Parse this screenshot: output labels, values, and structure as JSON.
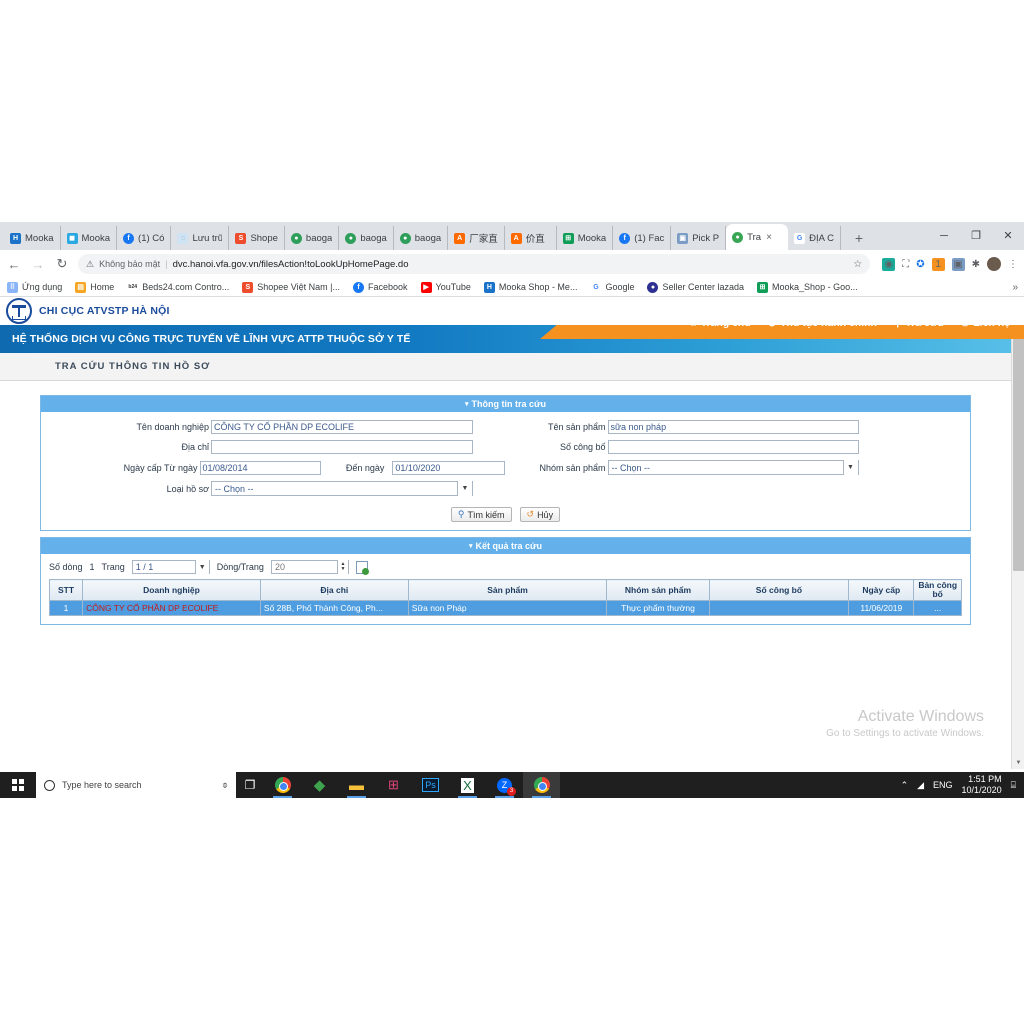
{
  "browser": {
    "tabs": [
      {
        "label": "Mooka",
        "favicon_name": "mooka-h-icon",
        "color": "#1a73c8",
        "glyph": "H",
        "active": false
      },
      {
        "label": "Mooka",
        "favicon_name": "mooka-square-icon",
        "color": "#29a9e1",
        "glyph": "■",
        "active": false
      },
      {
        "label": "(1) Có",
        "favicon_name": "facebook-icon",
        "color": "#1877f2",
        "glyph": "f",
        "active": false
      },
      {
        "label": "Lưu trữ",
        "favicon_name": "archive-icon",
        "color": "#e3eef7",
        "glyph": "◌",
        "active": false
      },
      {
        "label": "Shope",
        "favicon_name": "shopee-icon",
        "color": "#ee4d2d",
        "glyph": "S",
        "active": false
      },
      {
        "label": "baoga",
        "favicon_name": "globe-icon",
        "color": "#2e9e5b",
        "glyph": "●",
        "active": false
      },
      {
        "label": "baoga",
        "favicon_name": "globe-icon",
        "color": "#2e9e5b",
        "glyph": "●",
        "active": false
      },
      {
        "label": "baoga",
        "favicon_name": "globe-icon",
        "color": "#2e9e5b",
        "glyph": "●",
        "active": false
      },
      {
        "label": "厂家直",
        "favicon_name": "alibaba-icon",
        "color": "#ff6a00",
        "glyph": "ⓐ",
        "active": false
      },
      {
        "label": "价直",
        "favicon_name": "alibaba-icon",
        "color": "#ff6a00",
        "glyph": "ⓐ",
        "active": false
      },
      {
        "label": "Mooka",
        "favicon_name": "sheets-icon",
        "color": "#0f9d58",
        "glyph": "⌸",
        "active": false
      },
      {
        "label": "(1) Fac",
        "favicon_name": "facebook-icon",
        "color": "#1877f2",
        "glyph": "f",
        "active": false
      },
      {
        "label": "Pick P",
        "favicon_name": "image-icon",
        "color": "#7b9cc4",
        "glyph": "▣",
        "active": false
      },
      {
        "label": "Tra",
        "favicon_name": "portal-icon",
        "color": "#3aa655",
        "glyph": "●",
        "active": true
      },
      {
        "label": "ĐỊA C",
        "favicon_name": "google-icon",
        "color": "#ffffff",
        "glyph": "G",
        "active": false
      }
    ],
    "new_tab_label": "+",
    "tab_close_label": "×",
    "window_controls": {
      "minimize": "─",
      "maximize": "❐",
      "close": "✕"
    },
    "nav": {
      "back": "←",
      "forward": "→",
      "reload": "↻"
    },
    "omnibox": {
      "security_label": "Không bảo mật",
      "security_icon": "warning-triangle-icon",
      "separator": "|",
      "url": "dvc.hanoi.vfa.gov.vn/filesAction!toLookUpHomePage.do",
      "star_icon": "☆"
    },
    "toolbar_extensions": [
      {
        "name": "screen-capture-extension-icon",
        "glyph": "◉",
        "color": "#1aab9b"
      },
      {
        "name": "fullscreen-extension-icon",
        "glyph": "⛶",
        "color": "#5f6368"
      },
      {
        "name": "blue-circle-extension-icon",
        "glyph": "⊕",
        "color": "#1a73e8"
      },
      {
        "name": "counter-badge-extension-icon",
        "glyph": "1",
        "color": "#f5911e"
      },
      {
        "name": "image-extension-icon",
        "glyph": "▣",
        "color": "#7b9cc4"
      },
      {
        "name": "puzzle-extension-icon",
        "glyph": "❖",
        "color": "#5f6368"
      }
    ],
    "profile_avatar_name": "profile-avatar",
    "menu_icon": "⋮",
    "bookmarks": [
      {
        "label": "Ứng dụng",
        "icon_name": "apps-grid-icon",
        "color": "#8ab4f8",
        "glyph": "⠿"
      },
      {
        "label": "Home",
        "icon_name": "home-bookmark-icon",
        "color": "#f5a623",
        "glyph": "▤"
      },
      {
        "label": "Beds24.com Contro...",
        "icon_name": "beds24-icon",
        "color": "#ffffff",
        "glyph": "b24"
      },
      {
        "label": "Shopee Việt Nam |...",
        "icon_name": "shopee-icon",
        "color": "#ee4d2d",
        "glyph": "S"
      },
      {
        "label": "Facebook",
        "icon_name": "facebook-icon",
        "color": "#1877f2",
        "glyph": "f"
      },
      {
        "label": "YouTube",
        "icon_name": "youtube-icon",
        "color": "#ff0000",
        "glyph": "▶"
      },
      {
        "label": "Mooka Shop - Me...",
        "icon_name": "mooka-h-icon",
        "color": "#1a73c8",
        "glyph": "H"
      },
      {
        "label": "Google",
        "icon_name": "google-icon",
        "color": "#ffffff",
        "glyph": "G"
      },
      {
        "label": "Seller Center lazada",
        "icon_name": "lazada-icon",
        "color": "#2e3192",
        "glyph": "●"
      },
      {
        "label": "Mooka_Shop - Goo...",
        "icon_name": "sheets-icon",
        "color": "#0f9d58",
        "glyph": "⌸"
      }
    ],
    "bookmarks_overflow": "»"
  },
  "site": {
    "org_name": "CHI CỤC ATVSTP HÀ NỘI",
    "logo_name": "atvstp-logo",
    "nav": [
      {
        "label": "Trang chủ",
        "icon_name": "home-icon",
        "glyph": "⌂"
      },
      {
        "label": "Thủ tục hành chính",
        "icon_name": "globe-icon",
        "glyph": "⊕"
      },
      {
        "label": "Tra cứu",
        "icon_name": "search-icon",
        "glyph": "⚲"
      },
      {
        "label": "Liên hệ",
        "icon_name": "phone-icon",
        "glyph": "✆"
      }
    ],
    "banner": "HỆ THỐNG DỊCH VỤ CÔNG TRỰC TUYẾN VỀ LĨNH VỰC ATTP THUỘC SỞ Y TẾ",
    "page_title": "TRA CỨU THÔNG TIN HỒ SƠ"
  },
  "search_panel": {
    "header": "Thông tin tra cứu",
    "caret": "▾",
    "fields": {
      "enterprise_name": {
        "label": "Tên doanh nghiệp",
        "value": "CÔNG TY CỔ PHẦN DP ECOLIFE"
      },
      "product_name": {
        "label": "Tên sản phẩm",
        "value": "sữa non pháp"
      },
      "address": {
        "label": "Địa chỉ",
        "value": ""
      },
      "declaration_number": {
        "label": "Số công bố",
        "value": ""
      },
      "issue_date_from": {
        "label": "Ngày cấp Từ ngày",
        "value": "01/08/2014"
      },
      "issue_date_to": {
        "label": "Đến ngày",
        "value": "01/10/2020"
      },
      "product_group": {
        "label": "Nhóm sản phẩm",
        "value": "-- Chọn --"
      },
      "record_type": {
        "label": "Loại hồ sơ",
        "value": "-- Chọn --"
      }
    },
    "buttons": {
      "search": {
        "label": "Tìm kiếm",
        "icon_name": "search-icon",
        "glyph": "⚲"
      },
      "cancel": {
        "label": "Hủy",
        "icon_name": "refresh-icon",
        "glyph": "↺"
      }
    }
  },
  "results_panel": {
    "header": "Kết quả tra cứu",
    "caret": "▾",
    "toolbar": {
      "row_count_label": "Số dòng",
      "row_count_value": "1",
      "page_label": "Trang",
      "page_value": "1 / 1",
      "rows_per_page_label": "Dòng/Trang",
      "rows_per_page_value": "20",
      "export_icon_name": "export-excel-icon"
    },
    "columns": [
      "STT",
      "Doanh nghiệp",
      "Địa chỉ",
      "Sản phẩm",
      "Nhóm sản phẩm",
      "Số công bố",
      "Ngày cấp",
      "Bản công bố"
    ],
    "rows": [
      {
        "stt": "1",
        "enterprise": "CÔNG TY CỔ PHẦN DP ECOLIFE",
        "address": "Số 28B, Phố Thành Công, Ph...",
        "product": "Sữa non Pháp",
        "product_group": "Thực phẩm thường",
        "declaration_number": "",
        "issue_date": "11/06/2019",
        "declaration_file": "..."
      }
    ]
  },
  "watermark": {
    "line1": "Activate Windows",
    "line2": "Go to Settings to activate Windows."
  },
  "taskbar": {
    "start_icon_name": "windows-start-icon",
    "search_placeholder": "Type here to search",
    "search_icon_name": "search-circle-icon",
    "mic_icon": "⌥",
    "task_view_icon": "⧉",
    "apps": [
      {
        "name": "chrome-taskbar-icon",
        "glyph": "",
        "kind": "chrome",
        "running": true,
        "active": false
      },
      {
        "name": "sims-taskbar-icon",
        "glyph": "◆",
        "color": "#3fa34d",
        "running": false,
        "active": false
      },
      {
        "name": "file-explorer-taskbar-icon",
        "glyph": "▬",
        "color": "#f7c03a",
        "running": true,
        "active": false
      },
      {
        "name": "teams-taskbar-icon",
        "glyph": "⯃",
        "color": "#e0457b",
        "running": false,
        "active": false
      },
      {
        "name": "photoshop-taskbar-icon",
        "glyph": "Ps",
        "color": "#31a8ff",
        "running": false,
        "active": false
      },
      {
        "name": "excel-taskbar-icon",
        "glyph": "X",
        "color": "#1d6f42",
        "running": true,
        "active": false
      },
      {
        "name": "zalo-taskbar-icon",
        "glyph": "Z",
        "color": "#0068ff",
        "badge": "3",
        "running": true,
        "active": false
      },
      {
        "name": "chrome-active-taskbar-icon",
        "glyph": "",
        "kind": "chrome",
        "running": true,
        "active": true
      }
    ],
    "tray": {
      "chevron_icon": "⌃",
      "wifi_icon": "◢",
      "language": "ENG",
      "time": "1:51 PM",
      "date": "10/1/2020",
      "notification_icon": "⌸"
    }
  },
  "colors": {
    "orange": "#f5911e",
    "blue_panel_header": "#63b0eb",
    "row_highlight": "#4d9de0",
    "brand_blue": "#1a4b9c",
    "red_text": "#c21b1b"
  }
}
